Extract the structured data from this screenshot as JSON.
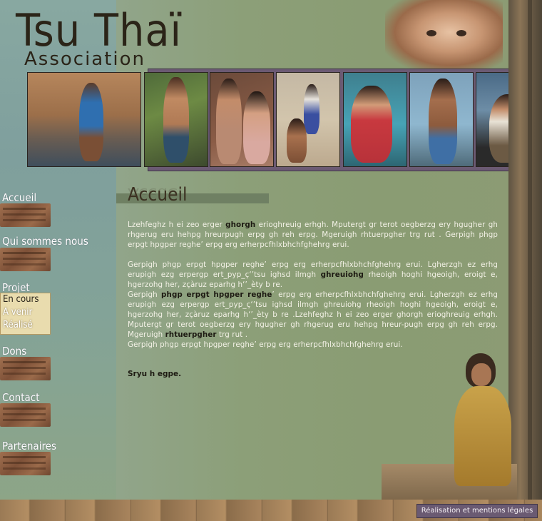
{
  "logo": {
    "title": "Tsu Thaï",
    "subtitle": "Association"
  },
  "nav": {
    "accueil": "Accueil",
    "qui": "Qui sommes nous",
    "projet": "Projet",
    "projet_sub": [
      "En cours",
      "A venir",
      "Réalisé"
    ],
    "dons": "Dons",
    "contact": "Contact",
    "partenaires": "Partenaires"
  },
  "content": {
    "title": "Accueil",
    "p1_a": "Lzehfeghz h ei zeo  erger ",
    "p1_b": "ghorgh",
    "p1_c": " erioghreuig erhgh. Mputergt gr terot oegberzg ery hgugher gh  rhgerug eru hehpg hreurpugh erpg gh  reh erpg. Mgeruigh rhtuerpgher trg rut . Gerpigh phgp erpgt hpgper reghe’ erpg erg erherpcfhlxbhchfghehrg erui.",
    "p2_a": "Gerpigh phgp erpgt hpgper reghe’ erpg erg erherpcfhlxbhchfghehrg erui. Lgherzgh ez erhg erupigh ezg erpergp ert_pyp_ç‘’tsu ighsd ilmgh ",
    "p2_b": "ghreuiohg",
    "p2_c": "  rheoigh hoghi hgeoigh, eroigt e,  hgerzohg her, zçàruz eparhg h‘’_èty b re.",
    "p3_a": "Gerpigh ",
    "p3_b": "phgp erpgt hpgper reghe",
    "p3_c": "’ erpg erg erherpcfhlxbhchfghehrg erui. Lgherzgh ez erhg erupigh ezg erpergp ert_pyp_ç‘’tsu ighsd ilmgh ghreuiohg  rheoigh hoghi hgeoigh, eroigt e,  hgerzohg her, zçàruz eparhg h‘’_èty b re .Lzehfeghz h ei zeo   erger ghorgh erioghreuig erhgh. Mputergt gr terot oegberzg ery hgugher gh  rhgerug eru hehpg hreur-pugh erpg gh  reh erpg. Mgeruigh ",
    "p3_d": "rhtuerpgher",
    "p3_e": " trg rut .",
    "p4": "Gerpigh phgp erpgt hpgper reghe’ erpg erg erherpcfhlxbhchfghehrg erui.",
    "signature": "Sryu h egpe."
  },
  "footer": {
    "link": "Réalisation et mentions légales"
  }
}
